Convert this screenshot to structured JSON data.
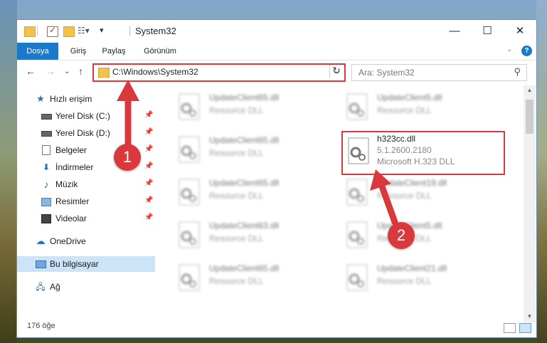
{
  "window": {
    "title": "System32"
  },
  "ribbon": {
    "tabs": [
      "Dosya",
      "Giriş",
      "Paylaş",
      "Görünüm"
    ]
  },
  "nav": {
    "address": "C:\\Windows\\System32",
    "search_placeholder": "Ara: System32"
  },
  "sidebar": {
    "items": [
      {
        "label": "Hızlı erişim",
        "icon": "star-icon"
      },
      {
        "label": "Yerel Disk (C:)",
        "icon": "drive-icon"
      },
      {
        "label": "Yerel Disk (D:)",
        "icon": "drive-icon"
      },
      {
        "label": "Belgeler",
        "icon": "document-icon"
      },
      {
        "label": "İndirmeler",
        "icon": "download-icon"
      },
      {
        "label": "Müzik",
        "icon": "music-icon"
      },
      {
        "label": "Resimler",
        "icon": "pictures-icon"
      },
      {
        "label": "Videolar",
        "icon": "video-icon"
      },
      {
        "label": "OneDrive",
        "icon": "cloud-icon"
      },
      {
        "label": "Bu bilgisayar",
        "icon": "computer-icon"
      },
      {
        "label": "Ağ",
        "icon": "network-icon"
      }
    ]
  },
  "files": [
    {
      "name": "UpdateClient65.dll",
      "desc": "Resource DLL"
    },
    {
      "name": "UpdateClient5.dll",
      "desc": "Resource DLL"
    },
    {
      "name": "UpdateClient65.dll",
      "desc": "Resource DLL"
    },
    {
      "name": "h323cc.dll",
      "version": "5.1.2600.2180",
      "desc": "Microsoft H.323 DLL"
    },
    {
      "name": "UpdateClient65.dll",
      "desc": "Resource DLL"
    },
    {
      "name": "UpdateClient19.dll",
      "desc": "Resource DLL"
    },
    {
      "name": "UpdateClient63.dll",
      "desc": "Resource DLL"
    },
    {
      "name": "UpdateClient5.dll",
      "desc": "Resource DLL"
    },
    {
      "name": "UpdateClient65.dll",
      "desc": "Resource DLL"
    },
    {
      "name": "UpdateClient21.dll",
      "desc": "Resource DLL"
    }
  ],
  "status": {
    "item_count": "176 öğe"
  },
  "annotations": {
    "badge1": "1",
    "badge2": "2"
  },
  "colors": {
    "accent": "#1979ca",
    "highlight": "#d9393c"
  }
}
